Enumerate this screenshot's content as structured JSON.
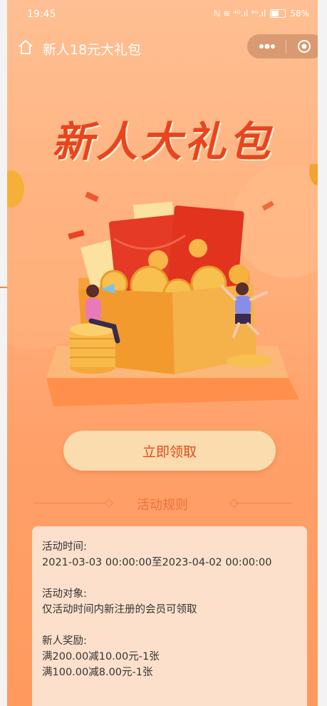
{
  "status_bar": {
    "time": "19:45",
    "signals": "ℕ ≋ ⁴ᴳ.ıl ⁴ᴳ.ıl",
    "battery": "58%"
  },
  "nav": {
    "title": "新人18元大礼包"
  },
  "hero": {
    "title": "新人大礼包"
  },
  "claim_button": "立即领取",
  "rules": {
    "heading": "活动规则",
    "time_label": "活动时间:",
    "time_value": "2021-03-03 00:00:00至2023-04-02 00:00:00",
    "target_label": "活动对象:",
    "target_value": "仅活动时间内新注册的会员可领取",
    "reward_label": "新人奖励:",
    "rewards": [
      "满200.00减10.00元-1张",
      "满100.00减8.00元-1张"
    ]
  },
  "colors": {
    "accent": "#e0491c",
    "background": "#ffae7a",
    "button_bg": "#fbdcae",
    "card_bg": "#fde0cb"
  }
}
